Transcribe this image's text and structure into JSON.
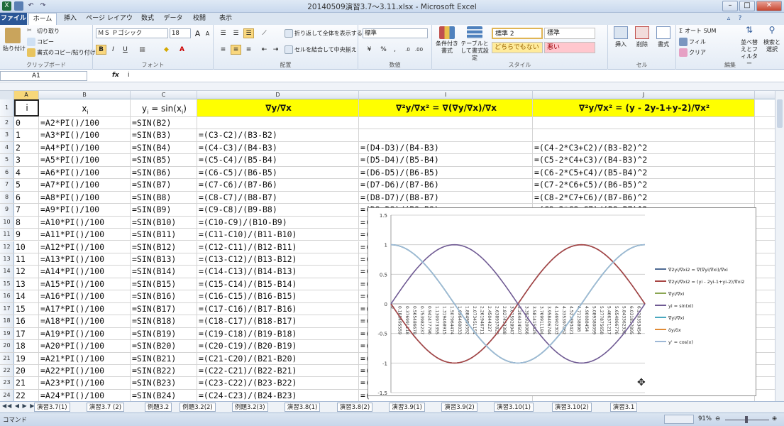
{
  "window": {
    "title": "20140509演習3.7～3.11.xlsx - Microsoft Excel"
  },
  "tabs": [
    "ファイル",
    "ホーム",
    "挿入",
    "ページ レイアウト",
    "数式",
    "データ",
    "校閲",
    "表示"
  ],
  "ribbon": {
    "clipboard": {
      "label": "クリップボード",
      "paste": "貼り付け",
      "cut": "切り取り",
      "copy": "コピー",
      "format_painter": "書式のコピー/貼り付け"
    },
    "font": {
      "label": "フォント",
      "name": "ＭＳ Ｐゴシック",
      "size": "18",
      "bold": "B",
      "italic": "I",
      "underline": "U",
      "grow": "A",
      "shrink": "A"
    },
    "alignment": {
      "label": "配置",
      "wrap": "折り返して全体を表示する",
      "merge": "セルを結合して中央揃え"
    },
    "number": {
      "label": "数値",
      "format": "標準",
      "currency": "¥",
      "percent": "%",
      "comma": ","
    },
    "styles": {
      "label": "スタイル",
      "conditional": "条件付き書式",
      "table": "テーブルとして書式設定",
      "style1": "標準 2",
      "style2": "標準",
      "style3": "どちらでもない",
      "style4": "悪い"
    },
    "cells": {
      "label": "セル",
      "insert": "挿入",
      "delete": "削除",
      "format": "書式"
    },
    "editing": {
      "label": "編集",
      "autosum": "オート SUM",
      "fill": "フィル",
      "clear": "クリア",
      "sort": "並べ替えとフィルター",
      "find": "検索と選択"
    }
  },
  "formula_bar": {
    "name_box": "A1",
    "fx": "fx",
    "value": "i"
  },
  "columns": [
    "A",
    "B",
    "C",
    "D",
    "I",
    "J"
  ],
  "header_row": {
    "num": "1",
    "a": "i",
    "b": "x",
    "b_sub": "i",
    "c_pre": "y",
    "c_sub1": "i",
    "c_mid": " = sin(x",
    "c_sub2": "i",
    "c_post": ")",
    "d": "∇y/∇x",
    "i": "∇²y/∇x² = ∇(∇y/∇x)/∇x",
    "j": "∇²y/∇x² = (y - 2y-1+y-2)/∇x²"
  },
  "rows": [
    {
      "num": "2",
      "a": "0",
      "b": "=A2*PI()/100",
      "c": "=SIN(B2)",
      "d": "",
      "i": "",
      "j": ""
    },
    {
      "num": "3",
      "a": "1",
      "b": "=A3*PI()/100",
      "c": "=SIN(B3)",
      "d": "=(C3-C2)/(B3-B2)",
      "i": "",
      "j": ""
    },
    {
      "num": "4",
      "a": "2",
      "b": "=A4*PI()/100",
      "c": "=SIN(B4)",
      "d": "=(C4-C3)/(B4-B3)",
      "i": "=(D4-D3)/(B4-B3)",
      "j": "=(C4-2*C3+C2)/(B3-B2)^2"
    },
    {
      "num": "5",
      "a": "3",
      "b": "=A5*PI()/100",
      "c": "=SIN(B5)",
      "d": "=(C5-C4)/(B5-B4)",
      "i": "=(D5-D4)/(B5-B4)",
      "j": "=(C5-2*C4+C3)/(B4-B3)^2"
    },
    {
      "num": "6",
      "a": "4",
      "b": "=A6*PI()/100",
      "c": "=SIN(B6)",
      "d": "=(C6-C5)/(B6-B5)",
      "i": "=(D6-D5)/(B6-B5)",
      "j": "=(C6-2*C5+C4)/(B5-B4)^2"
    },
    {
      "num": "7",
      "a": "5",
      "b": "=A7*PI()/100",
      "c": "=SIN(B7)",
      "d": "=(C7-C6)/(B7-B6)",
      "i": "=(D7-D6)/(B7-B6)",
      "j": "=(C7-2*C6+C5)/(B6-B5)^2"
    },
    {
      "num": "8",
      "a": "6",
      "b": "=A8*PI()/100",
      "c": "=SIN(B8)",
      "d": "=(C8-C7)/(B8-B7)",
      "i": "=(D8-D7)/(B8-B7)",
      "j": "=(C8-2*C7+C6)/(B7-B6)^2"
    },
    {
      "num": "9",
      "a": "7",
      "b": "=A9*PI()/100",
      "c": "=SIN(B9)",
      "d": "=(C9-C8)/(B9-B8)",
      "i": "=(D9-D8)/(B9-B8)",
      "j": "=(C9-2*C8+C7)/(B8-B7)^2"
    },
    {
      "num": "10",
      "a": "8",
      "b": "=A10*PI()/100",
      "c": "=SIN(B10)",
      "d": "=(C10-C9)/(B10-B9)",
      "i": "=(",
      "j": ""
    },
    {
      "num": "11",
      "a": "9",
      "b": "=A11*PI()/100",
      "c": "=SIN(B11)",
      "d": "=(C11-C10)/(B11-B10)",
      "i": "=(",
      "j": ""
    },
    {
      "num": "12",
      "a": "10",
      "b": "=A12*PI()/100",
      "c": "=SIN(B12)",
      "d": "=(C12-C11)/(B12-B11)",
      "i": "=(",
      "j": ""
    },
    {
      "num": "13",
      "a": "11",
      "b": "=A13*PI()/100",
      "c": "=SIN(B13)",
      "d": "=(C13-C12)/(B13-B12)",
      "i": "=(",
      "j": ""
    },
    {
      "num": "14",
      "a": "12",
      "b": "=A14*PI()/100",
      "c": "=SIN(B14)",
      "d": "=(C14-C13)/(B14-B13)",
      "i": "=(",
      "j": ""
    },
    {
      "num": "15",
      "a": "13",
      "b": "=A15*PI()/100",
      "c": "=SIN(B15)",
      "d": "=(C15-C14)/(B15-B14)",
      "i": "=(",
      "j": ""
    },
    {
      "num": "16",
      "a": "14",
      "b": "=A16*PI()/100",
      "c": "=SIN(B16)",
      "d": "=(C16-C15)/(B16-B15)",
      "i": "=(",
      "j": ""
    },
    {
      "num": "17",
      "a": "15",
      "b": "=A17*PI()/100",
      "c": "=SIN(B17)",
      "d": "=(C17-C16)/(B17-B16)",
      "i": "=(",
      "j": ""
    },
    {
      "num": "18",
      "a": "16",
      "b": "=A18*PI()/100",
      "c": "=SIN(B18)",
      "d": "=(C18-C17)/(B18-B17)",
      "i": "=(",
      "j": ""
    },
    {
      "num": "19",
      "a": "17",
      "b": "=A19*PI()/100",
      "c": "=SIN(B19)",
      "d": "=(C19-C18)/(B19-B18)",
      "i": "=(",
      "j": ""
    },
    {
      "num": "20",
      "a": "18",
      "b": "=A20*PI()/100",
      "c": "=SIN(B20)",
      "d": "=(C20-C19)/(B20-B19)",
      "i": "=(",
      "j": ""
    },
    {
      "num": "21",
      "a": "19",
      "b": "=A21*PI()/100",
      "c": "=SIN(B21)",
      "d": "=(C21-C20)/(B21-B20)",
      "i": "=(",
      "j": ""
    },
    {
      "num": "22",
      "a": "20",
      "b": "=A22*PI()/100",
      "c": "=SIN(B22)",
      "d": "=(C22-C21)/(B22-B21)",
      "i": "=(",
      "j": ""
    },
    {
      "num": "23",
      "a": "21",
      "b": "=A23*PI()/100",
      "c": "=SIN(B23)",
      "d": "=(C23-C22)/(B23-B22)",
      "i": "=(",
      "j": ""
    },
    {
      "num": "24",
      "a": "22",
      "b": "=A24*PI()/100",
      "c": "=SIN(B24)",
      "d": "=(C24-C23)/(B24-B23)",
      "i": "=(",
      "j": ""
    }
  ],
  "sheet_tabs": [
    "演習3.7(1)",
    "演習3.7 (2)",
    "例題3.2",
    "例題3.2(2)",
    "例題3.2(3)",
    "演習3.8(1)",
    "演習3.8(2)",
    "演習3.9(1)",
    "演習3.9(2)",
    "演習3.10(1)",
    "演習3.10(2)",
    "演習3.1"
  ],
  "status": {
    "mode": "コマンド",
    "zoom": "91%"
  },
  "chart_data": {
    "type": "line",
    "ylim": [
      -1.5,
      1.5
    ],
    "y_ticks": [
      "1.5",
      "1",
      "0.5",
      "0",
      "-0.5",
      "-1",
      "-1.5"
    ],
    "x_tick_labels": [
      "0",
      "0.188495559",
      "0.376991118",
      "0.565486678",
      "0.753982237",
      "0.942477796",
      "1.130973355",
      "1.319468915",
      "1.507964474",
      "1.696460033",
      "1.884955592",
      "2.073451151",
      "2.261946711",
      "2.45044227",
      "2.638937829",
      "2.827433388",
      "3.015928947",
      "3.204424507",
      "3.392920066",
      "3.581415625",
      "3.769911184",
      "3.958406744",
      "4.146902303",
      "4.335397862",
      "4.523893421",
      "4.71238898",
      "4.90088454",
      "5.089380099",
      "5.277875658",
      "5.466371217",
      "5.654866776",
      "5.843362336",
      "6.031857895",
      "6.220353454"
    ],
    "x_range": [
      0,
      6.2832
    ],
    "series": [
      {
        "name": "∇2yi/∇xi2 = ∇(∇yi/∇xi)/∇xi",
        "color": "#4f6b94",
        "fn": "-sin"
      },
      {
        "name": "∇2yi/∇xi2 = (yi - 2yi-1+yi-2)/∇xi2",
        "color": "#a84543",
        "fn": "-sin"
      },
      {
        "name": "∇yi/∇xi",
        "color": "#8ba653",
        "fn": "cos"
      },
      {
        "name": "yi = sin(xi)",
        "color": "#6f5a93",
        "fn": "sin"
      },
      {
        "name": "∇yi/∇xi",
        "color": "#4aa8bf",
        "fn": "cos"
      },
      {
        "name": "δy/δx",
        "color": "#e08b36",
        "fn": "none"
      },
      {
        "name": "y' = cos(x)",
        "color": "#9eb8d6",
        "fn": "cos"
      }
    ]
  }
}
